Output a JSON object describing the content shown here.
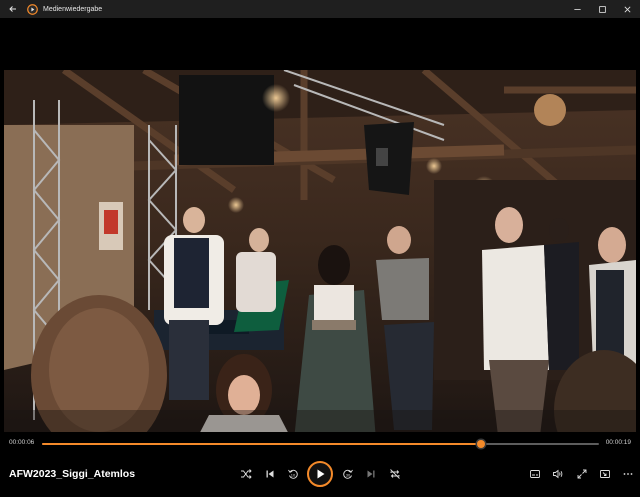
{
  "window": {
    "title": "Medienwiedergabe"
  },
  "player": {
    "current_time": "00:00:06",
    "total_time": "00:00:19",
    "progress": 0.789,
    "media_title": "AFW2023_Siggi_Atemlos"
  },
  "colors": {
    "accent": "#f48a2a",
    "titlebar": "#1f1f1f"
  },
  "icons": {
    "back": "back-arrow-icon",
    "app": "media-player-icon",
    "minimize": "minimize-icon",
    "maximize": "maximize-icon",
    "close": "close-icon",
    "shuffle": "shuffle-icon",
    "previous": "previous-icon",
    "skip_back": "skip-back-10-icon",
    "play": "play-icon",
    "skip_forward": "skip-forward-30-icon",
    "next": "next-icon",
    "repeat": "repeat-off-icon",
    "subtitles": "subtitles-icon",
    "volume": "volume-icon",
    "fullscreen": "fullscreen-icon",
    "miniplayer": "miniplayer-icon",
    "more": "more-options-icon"
  }
}
